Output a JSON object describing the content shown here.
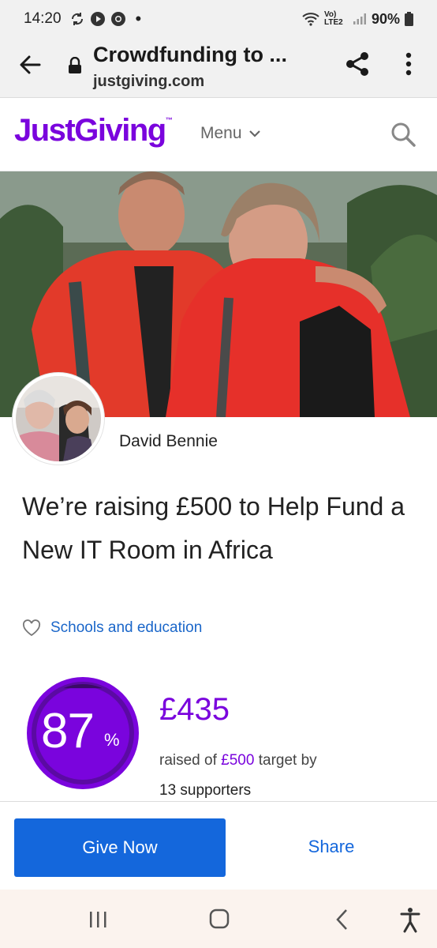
{
  "status_bar": {
    "time": "14:20",
    "network": "Vo) LTE2",
    "battery": "90%"
  },
  "browser": {
    "title": "Crowdfunding to ...",
    "domain": "justgiving.com"
  },
  "site_header": {
    "logo": "JustGiving",
    "logo_tm": "™",
    "menu_label": "Menu"
  },
  "page": {
    "owner_name": "David Bennie",
    "headline": "We’re raising £500 to Help Fund a New IT Room in Africa",
    "category": "Schools and education",
    "progress_percent": "87",
    "progress_symbol": "%",
    "progress_fraction": 0.87,
    "raised_amount": "£435",
    "raised_prefix": "raised of",
    "target_amount": "£500",
    "raised_suffix": "target by",
    "supporters": "13 supporters"
  },
  "actions": {
    "give_label": "Give Now",
    "share_label": "Share"
  },
  "colors": {
    "brand_purple": "#7a04dd",
    "button_blue": "#1467dc",
    "link_blue": "#1a66c9"
  }
}
